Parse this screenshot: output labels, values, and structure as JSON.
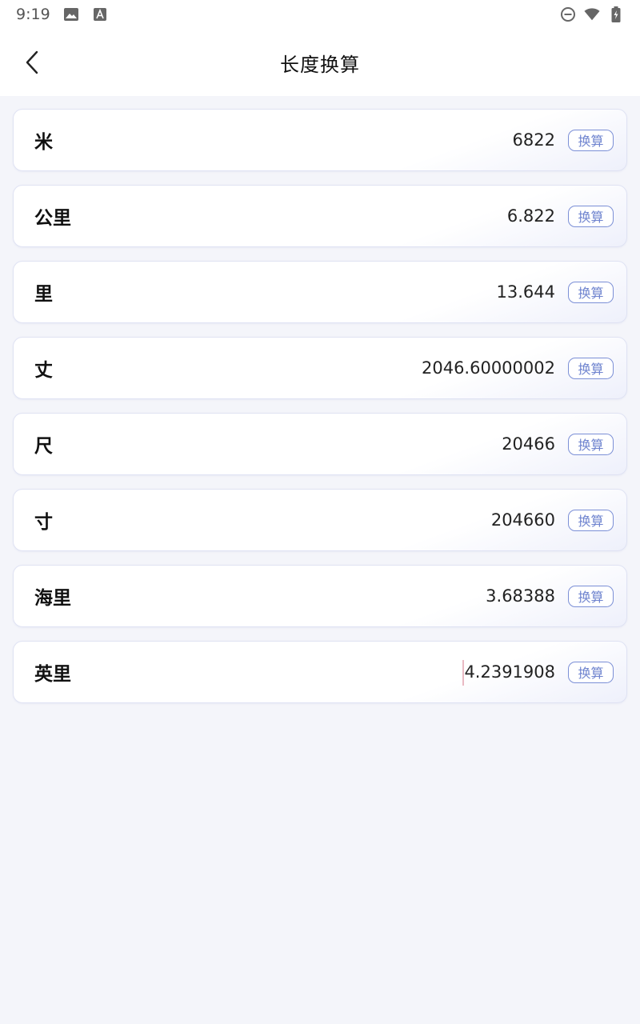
{
  "status_bar": {
    "time": "9:19"
  },
  "header": {
    "title": "长度换算"
  },
  "rows": [
    {
      "label": "米",
      "value": "6822",
      "button": "换算"
    },
    {
      "label": "公里",
      "value": "6.822",
      "button": "换算"
    },
    {
      "label": "里",
      "value": "13.644",
      "button": "换算"
    },
    {
      "label": "丈",
      "value": "2046.60000002",
      "button": "换算"
    },
    {
      "label": "尺",
      "value": "20466",
      "button": "换算"
    },
    {
      "label": "寸",
      "value": "204660",
      "button": "换算"
    },
    {
      "label": "海里",
      "value": "3.68388",
      "button": "换算"
    },
    {
      "label": "英里",
      "value": "4.2391908",
      "button": "换算"
    }
  ],
  "colors": {
    "accent": "#7b8fd6",
    "background": "#f4f5fa"
  }
}
